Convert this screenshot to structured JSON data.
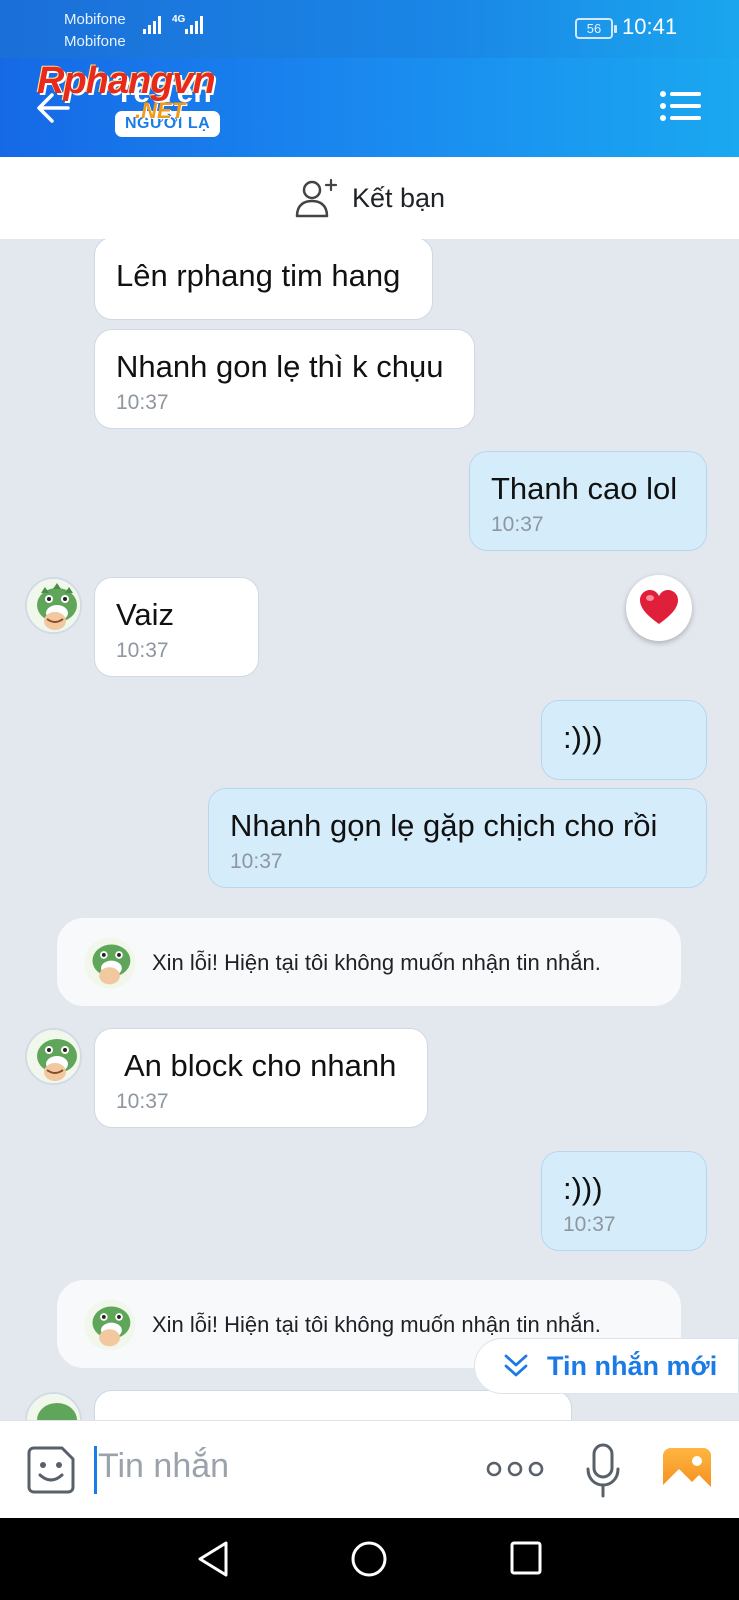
{
  "status_bar": {
    "carrier_1": "Mobifone",
    "carrier_2": "Mobifone",
    "network": "4G",
    "battery": "56",
    "time": "10:41"
  },
  "header": {
    "contact_name": "Tè Tèn",
    "badge": "NGƯỜI LẠ",
    "watermark_1": "Rphangvn",
    "watermark_2": ".NET"
  },
  "add_friend": {
    "label": "Kết bạn"
  },
  "messages": [
    {
      "side": "in",
      "text": "Lên rphang tim hang"
    },
    {
      "side": "in",
      "text": "Nhanh gon lẹ thì k chụu",
      "time": "10:37"
    },
    {
      "side": "out",
      "text": "Thanh cao lol",
      "time": "10:37"
    },
    {
      "side": "in",
      "text": "Vaiz",
      "time": "10:37",
      "reaction": "heart"
    },
    {
      "side": "out",
      "text": ":)))"
    },
    {
      "side": "out",
      "text": "Nhanh gọn lẹ gặp chịch cho rồi",
      "time": "10:37"
    },
    {
      "side": "system",
      "text": "Xin lỗi! Hiện tại tôi không muốn nhận tin nhắn."
    },
    {
      "side": "in",
      "text": "An block cho nhanh",
      "time": "10:37"
    },
    {
      "side": "out",
      "text": ":)))",
      "time": "10:37"
    },
    {
      "side": "system",
      "text": "Xin lỗi! Hiện tại tôi không muốn nhận tin nhắn."
    }
  ],
  "new_messages": {
    "label": "Tin nhắn mới"
  },
  "composer": {
    "placeholder": "Tin nhắn"
  },
  "icons": {
    "back": "arrow-left-icon",
    "menu": "menu-icon",
    "add_friend": "user-plus-icon",
    "emoji": "sticker-icon",
    "more": "more-dots-icon",
    "mic": "microphone-icon",
    "gallery": "image-icon",
    "reaction": "heart-icon",
    "new_messages": "double-chevron-down-icon"
  },
  "colors": {
    "header": "#1a86e6",
    "outgoing_bubble": "#d5ecfb",
    "incoming_bubble": "#ffffff",
    "accent": "#1a7ce6"
  }
}
